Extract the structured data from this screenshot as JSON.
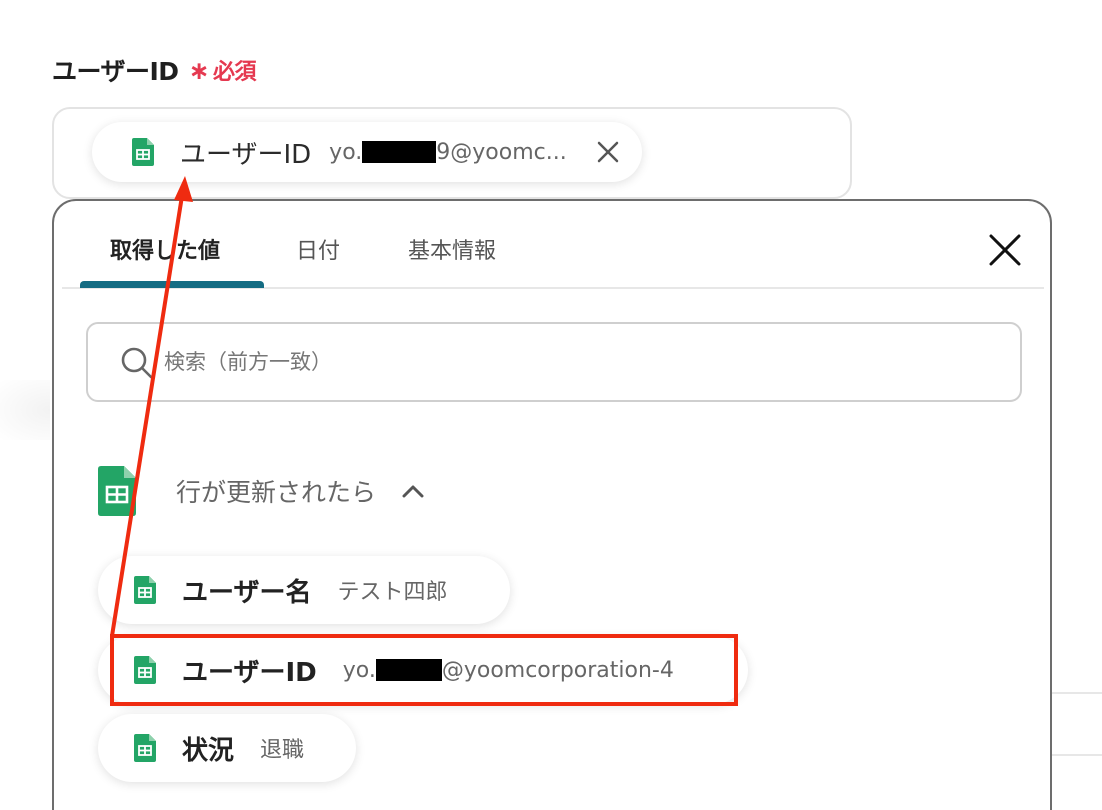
{
  "field": {
    "label": "ユーザーID",
    "asterisk": "∗",
    "required": "必須"
  },
  "selected_chip": {
    "label": "ユーザーID",
    "value_prefix": "yo.",
    "value_suffix": "9@yoomc..."
  },
  "popup": {
    "tabs": [
      {
        "label": "取得した値",
        "active": true
      },
      {
        "label": "日付",
        "active": false
      },
      {
        "label": "基本情報",
        "active": false
      }
    ],
    "search": {
      "placeholder": "検索（前方一致）",
      "value": ""
    },
    "group": {
      "title": "行が更新されたら",
      "expanded": true
    },
    "items": [
      {
        "label": "ユーザー名",
        "value": "テスト四郎"
      },
      {
        "label": "ユーザーID",
        "value_prefix": "yo.",
        "value_suffix": "@yoomcorporation-4"
      },
      {
        "label": "状況",
        "value": "退職"
      }
    ]
  },
  "colors": {
    "required": "#e53950",
    "tab_accent": "#146c83",
    "annotation": "#ef2b10",
    "sheets_green": "#23a566"
  },
  "icons": {
    "sheet": "google-sheets-icon",
    "search": "search-icon",
    "close": "close-icon",
    "chevron": "chevron-up-icon"
  }
}
